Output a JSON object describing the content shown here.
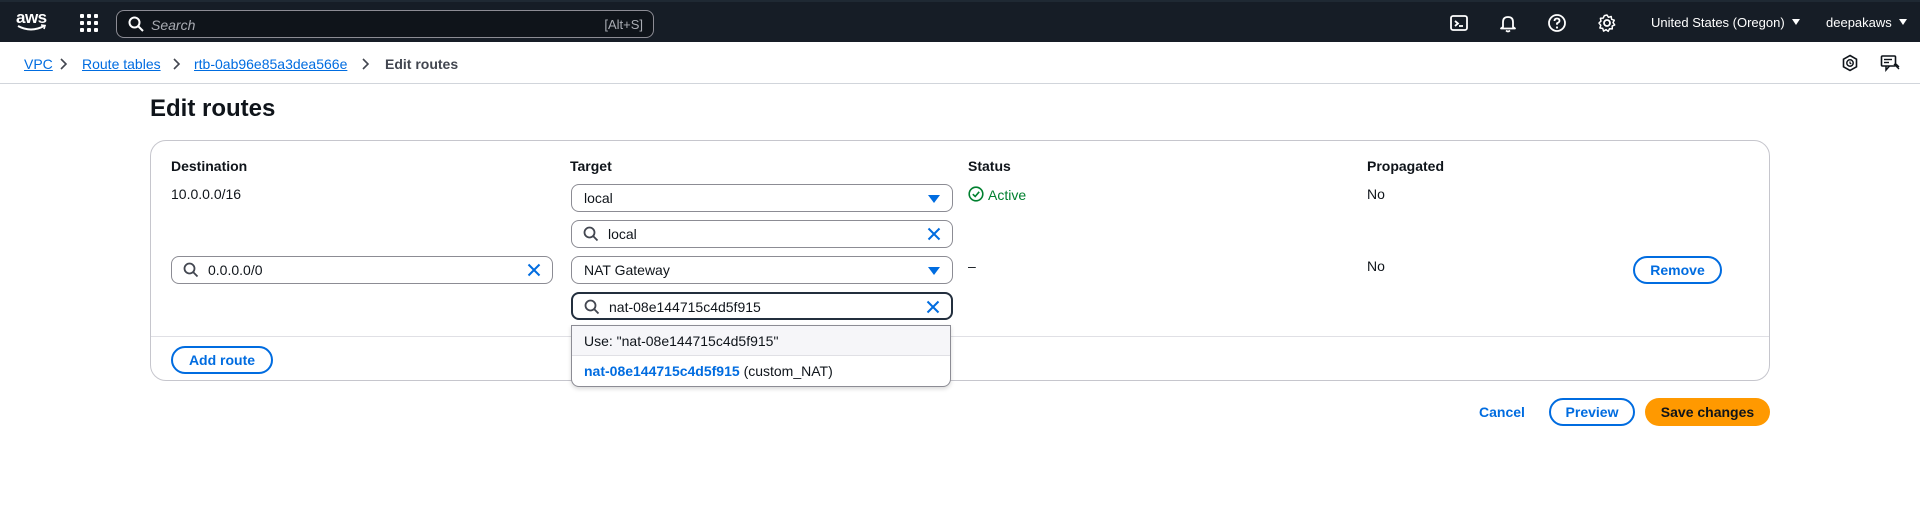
{
  "topnav": {
    "logo_text": "aws",
    "search_placeholder": "Search",
    "search_shortcut": "[Alt+S]",
    "region": "United States (Oregon)",
    "user": "deepakaws"
  },
  "breadcrumb": {
    "items": [
      "VPC",
      "Route tables",
      "rtb-0ab96e85a3dea566e"
    ],
    "current": "Edit routes"
  },
  "page_title": "Edit routes",
  "routes_table": {
    "headers": {
      "destination": "Destination",
      "target": "Target",
      "status": "Status",
      "propagated": "Propagated"
    },
    "rows": [
      {
        "destination": "10.0.0.0/16",
        "target_type": "local",
        "target_filter": "local",
        "status": "Active",
        "propagated": "No"
      },
      {
        "destination": "0.0.0.0/0",
        "target_type": "NAT Gateway",
        "target_filter": "nat-08e144715c4d5f915",
        "status": "–",
        "propagated": "No",
        "remove_label": "Remove"
      }
    ],
    "add_route_label": "Add route"
  },
  "autocomplete": {
    "use_option": "Use: \"nat-08e144715c4d5f915\"",
    "match_id": "nat-08e144715c4d5f915",
    "match_tag": "(custom_NAT)"
  },
  "footer": {
    "cancel_label": "Cancel",
    "preview_label": "Preview",
    "save_label": "Save changes"
  },
  "colors": {
    "nav_bg": "#161d26",
    "link": "#006ce0",
    "primary": "#ff9900",
    "success": "#00802f"
  }
}
